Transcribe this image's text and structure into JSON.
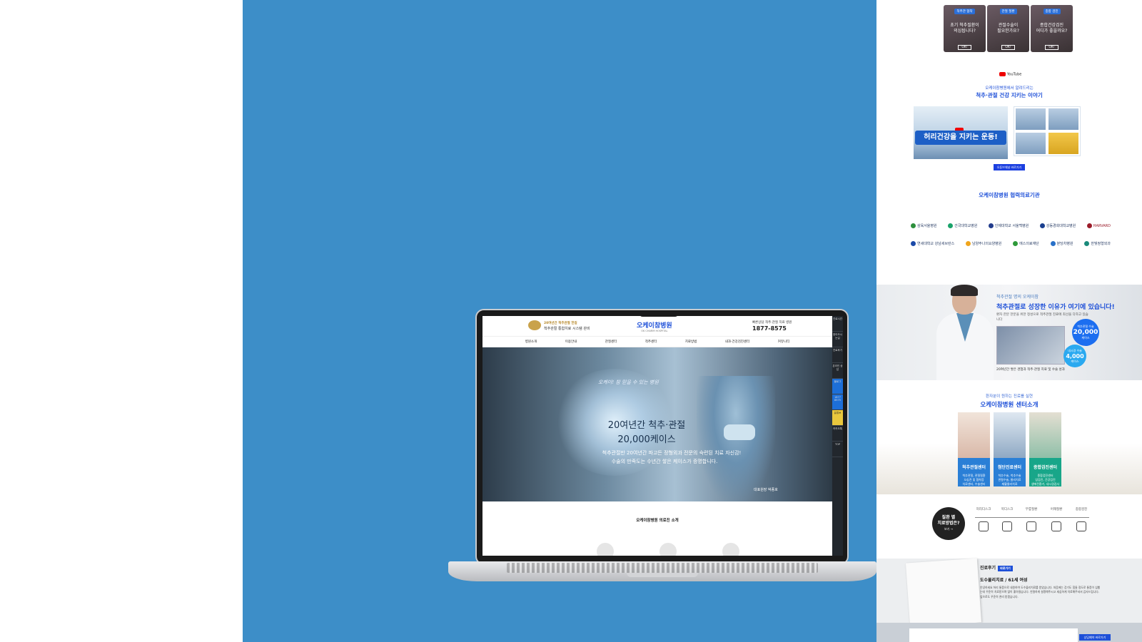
{
  "right": {
    "tiles": [
      {
        "tag": "척추관 협착",
        "text": "초기 척추질환이\n의심됩니다?",
        "btn": "OK!"
      },
      {
        "tag": "관절 질환",
        "text": "관절수술이\n필요한가요?",
        "btn": "OK!"
      },
      {
        "tag": "종합 검진",
        "text": "종합건강검진\n어디가 좋을까요?",
        "btn": "OK!"
      }
    ],
    "youtube": {
      "logo": "YouTube",
      "sub": "오케이참병원에서 알려드리는",
      "title": "척추·관절 건강 지키는 이야기",
      "thumb_caption": "허리건강을 지키는 운동!",
      "button": "유튜브채널 바로가기"
    },
    "partners": {
      "title": "오케이참병원 협력의료기관",
      "row1": [
        "삼육서울병원",
        "건국대학교병원",
        "인제대학교 서울백병원",
        "강동경희대학교병원",
        "HARVARD"
      ],
      "row2": [
        "연세대학교 강남세브란스",
        "남양주나의요양병원",
        "에스의료재단",
        "분당차병원",
        "한빛정형외과"
      ]
    },
    "doctor": {
      "eyebrow": "척추관절 명의 오케이참",
      "title": "척추관절로 성장한 이유가 여기에 있습니다!",
      "desc": "환자 한분 한분을 위한 정성으로 척추관절 진료에 최선을 다하고 있습니다",
      "caption": "20여년간 쌓은 경험과 척추·관절 치료 및 수술 성과",
      "badge1_label": "척추관절 수술",
      "badge1_value": "20,000",
      "badge1_unit": "케이스",
      "badge2_label": "내시경 수술",
      "badge2_value": "4,000",
      "badge2_unit": "케이스"
    },
    "centers": {
      "sub": "환자분이 원하는 진료를 실현",
      "title": "오케이참병원 센터소개",
      "items": [
        {
          "name": "척추관절센터",
          "desc": "척추관절, 관절질환\n오십견 및 협착증\n치료센터, 수술센터"
        },
        {
          "name": "첨단진료센터",
          "desc": "척추수술, 척추수술\n관절수술, 물리치료\n재활물리치료"
        },
        {
          "name": "종합검진센터",
          "desc": "종합검진센터\n암검진, 건강검진\n생애전환기, 내시경검사"
        }
      ]
    },
    "disease": {
      "circle_title": "질환 별\n치료방법은?",
      "circle_link": "보기 →",
      "items": [
        "허리디스크",
        "목디스크",
        "무릎질환",
        "어깨질환",
        "종합검진"
      ]
    },
    "review": {
      "label": "진료후기",
      "tag": "바로가기",
      "subject": "도수물리치료 / 61세 여성",
      "body": "안녕하세요 허리 통증으로 내원하여 도수물리치료를 받았습니다. 처음에는 걷기도 힘들 정도로 통증이 심했는데 꾸준히 치료받으며 많이 좋아졌습니다. 친절하게 설명해주시고 세심하게 치료해주셔서 감사드립니다. 앞으로도 꾸준히 관리 받겠습니다.",
      "button": "상담예약 바로가기"
    }
  },
  "laptop": {
    "site": {
      "award_line1": "20여년간 척추관절 한길",
      "award_line2": "척추관절 통합치료 시스템 완비",
      "logo": "오케이참병원",
      "logo_sub": "OK CHARM HOSPITAL",
      "call_label": "빠른상담   척추·관절 치료 병원",
      "call_number": "1877-8575",
      "nav": [
        "병원소개",
        "이용안내",
        "관절센터",
        "척추센터",
        "치료방법",
        "내과·건강검진센터",
        "커뮤니티"
      ],
      "hero_script": "오케이! 참 믿을 수 있는 병원",
      "hero_title1": "20여년간 척추·관절",
      "hero_title2": "20,000케이스",
      "hero_sub1": "척추관절만 20여년간 파고든 정형외과 전문의 숙련된 치료 자신감!",
      "hero_sub2": "수술의 만족도는 수년간 쌓은 케이스가 증명합니다.",
      "signature": "대표원장 박종호",
      "intro": "오케이참병원 의료진 소개",
      "side_items": [
        "진료시간",
        "찾아오시는길",
        "진료후기",
        "온라인 상담",
        "블로그",
        "1877 8575",
        "유튜브",
        "카카오톡",
        "TOP"
      ]
    }
  }
}
